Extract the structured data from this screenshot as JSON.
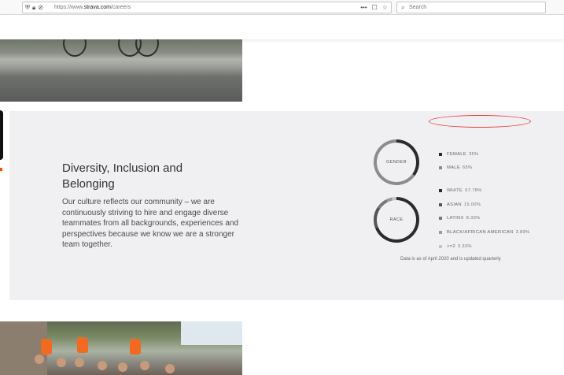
{
  "browser": {
    "url_prefix": "https://www.",
    "url_host": "strava.com",
    "url_path": "/careers",
    "search_placeholder": "Search",
    "icons": [
      "shield-icon",
      "lock-icon",
      "tracking-icon",
      "more-icon",
      "pocket-icon",
      "bookmark-star-icon",
      "search-icon"
    ]
  },
  "diversity": {
    "heading": "Diversity, Inclusion and Belonging",
    "body": "Our culture reflects our community – we are continuously striving to hire and engage diverse teammates from all backgrounds, experiences and perspectives because we know we are a stronger team together.",
    "gender_chart": {
      "label": "GENDER",
      "segments": [
        {
          "name": "FEMALE",
          "value_text": "35%",
          "value": 35,
          "color": "#2b2b2b"
        },
        {
          "name": "MALE",
          "value_text": "65%",
          "value": 65,
          "color": "#8c8c8c"
        }
      ]
    },
    "race_chart": {
      "label": "RACE",
      "segments": [
        {
          "name": "WHITE",
          "value_text": "67.78%",
          "value": 67.78,
          "color": "#2b2b2b"
        },
        {
          "name": "ASIAN",
          "value_text": "15.00%",
          "value": 15.0,
          "color": "#555555"
        },
        {
          "name": "LATINX",
          "value_text": "8.33%",
          "value": 8.33,
          "color": "#777777"
        },
        {
          "name": "BLACK/AFRICAN AMERICAN",
          "value_text": "3.89%",
          "value": 3.89,
          "color": "#9a9a9a"
        },
        {
          "name": ">=2",
          "value_text": "3.33%",
          "value": 3.33,
          "color": "#c4c4c4"
        }
      ]
    },
    "note": "Data is as of April 2020 and is updated quarterly"
  },
  "colors": {
    "section_bg": "#f0f0f2",
    "brand_orange": "#fc4c02",
    "highlight": "#e23b3b"
  }
}
